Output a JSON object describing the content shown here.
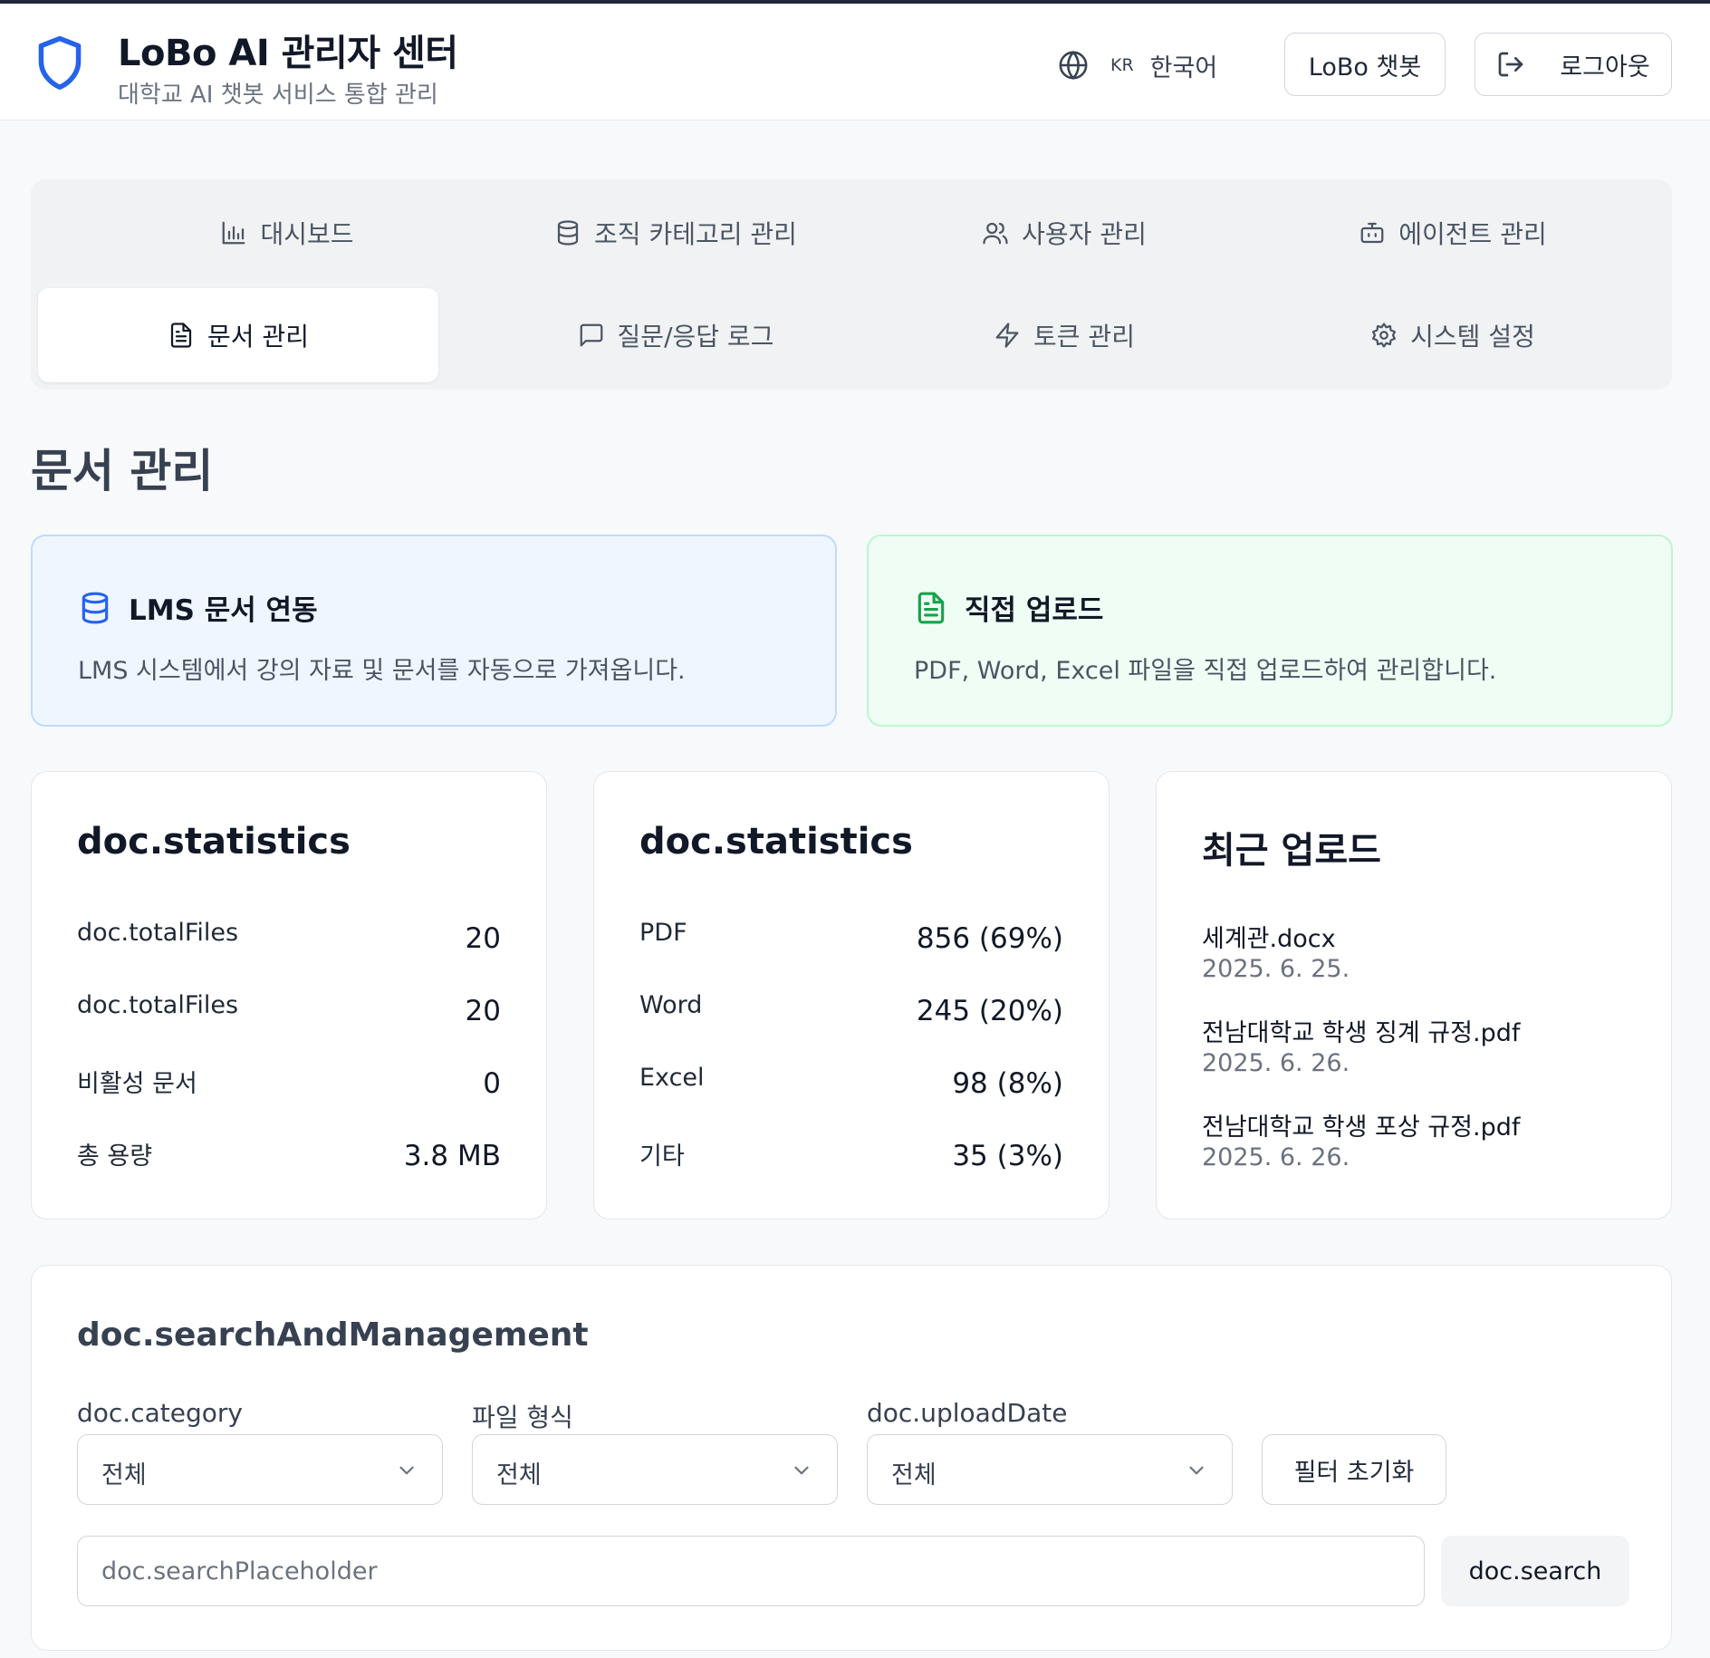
{
  "header": {
    "title": "LoBo AI 관리자 센터",
    "subtitle": "대학교 AI 챗봇 서비스 통합 관리",
    "language_code": "KR",
    "language_name": "한국어",
    "chat_button": "LoBo 챗봇",
    "logout_button": "로그아웃"
  },
  "nav": {
    "tabs": [
      {
        "label": "대시보드",
        "icon": "bar-chart-icon"
      },
      {
        "label": "조직 카테고리 관리",
        "icon": "database-icon"
      },
      {
        "label": "사용자 관리",
        "icon": "users-icon"
      },
      {
        "label": "에이전트 관리",
        "icon": "bot-icon"
      },
      {
        "label": "문서 관리",
        "icon": "file-text-icon",
        "active": true
      },
      {
        "label": "질문/응답 로그",
        "icon": "message-square-icon"
      },
      {
        "label": "토큰 관리",
        "icon": "zap-icon"
      },
      {
        "label": "시스템 설정",
        "icon": "settings-icon"
      }
    ]
  },
  "page": {
    "title": "문서 관리"
  },
  "info_cards": {
    "lms": {
      "title": "LMS 문서 연동",
      "description": "LMS 시스템에서 강의 자료 및 문서를 자동으로 가져옵니다.",
      "icon": "database-icon",
      "color": "#2563eb"
    },
    "upload": {
      "title": "직접 업로드",
      "description": "PDF, Word, Excel 파일을 직접 업로드하여 관리합니다.",
      "icon": "file-text-icon",
      "color": "#16a34a"
    }
  },
  "stats_card": {
    "title": "doc.statistics",
    "rows": [
      {
        "label": "doc.totalFiles",
        "value": "20"
      },
      {
        "label": "doc.totalFiles",
        "value": "20"
      },
      {
        "label": "비활성 문서",
        "value": "0"
      },
      {
        "label": "총 용량",
        "value": "3.8 MB"
      }
    ]
  },
  "types_card": {
    "title": "doc.statistics",
    "rows": [
      {
        "label": "PDF",
        "value": "856 (69%)"
      },
      {
        "label": "Word",
        "value": "245 (20%)"
      },
      {
        "label": "Excel",
        "value": "98 (8%)"
      },
      {
        "label": "기타",
        "value": "35 (3%)"
      }
    ]
  },
  "recent_card": {
    "title": "최근 업로드",
    "items": [
      {
        "name": "세계관.docx",
        "date": "2025. 6. 25."
      },
      {
        "name": "전남대학교 학생 징계 규정.pdf",
        "date": "2025. 6. 26."
      },
      {
        "name": "전남대학교 학생 포상 규정.pdf",
        "date": "2025. 6. 26."
      }
    ]
  },
  "search": {
    "title": "doc.searchAndManagement",
    "filters": [
      {
        "label": "doc.category",
        "value": "전체"
      },
      {
        "label": "파일 형식",
        "value": "전체"
      },
      {
        "label": "doc.uploadDate",
        "value": "전체"
      }
    ],
    "reset_button": "필터 초기화",
    "placeholder": "doc.searchPlaceholder",
    "search_button": "doc.search"
  },
  "colors": {
    "accent": "#2563eb",
    "success": "#16a34a",
    "background": "#f8f9fb"
  }
}
